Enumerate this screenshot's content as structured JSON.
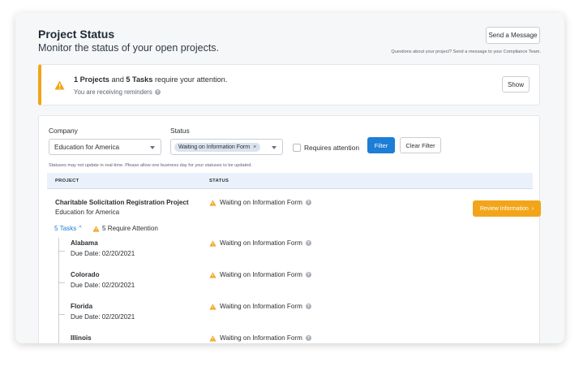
{
  "header": {
    "title": "Project Status",
    "subtitle": "Monitor the status of your open projects.",
    "send_label": "Send a Message",
    "help_text": "Questions about your project? Send a message to your Compliance Team."
  },
  "alert": {
    "projects_count": "1 Projects",
    "and_text": " and ",
    "tasks_count": "5 Tasks",
    "tail_text": " require your attention.",
    "sub_text": "You are receiving reminders",
    "show_label": "Show"
  },
  "filters": {
    "company_label": "Company",
    "company_value": "Education for America",
    "status_label": "Status",
    "status_chip": "Waiting on Information Form",
    "status_chip_remove": "×",
    "requires_label": "Requires attention",
    "filter_label": "Filter",
    "clear_label": "Clear Filter",
    "note": "Statuses may not update in real-time. Please allow one business day for your statuses to be updated."
  },
  "table": {
    "col_project": "PROJECT",
    "col_status": "STATUS",
    "project": {
      "name": "Charitable Solicitation Registration Project",
      "company": "Education for America",
      "status": "Waiting on Information Form",
      "review_label": "Review Information",
      "review_chevron": "›",
      "tasks_link": "5 Tasks",
      "tasks_chevron": "^",
      "attention": "5 Require Attention"
    },
    "tasks": [
      {
        "name": "Alabama",
        "due": "Due Date: 02/20/2021",
        "status": "Waiting on Information Form"
      },
      {
        "name": "Colorado",
        "due": "Due Date: 02/20/2021",
        "status": "Waiting on Information Form"
      },
      {
        "name": "Florida",
        "due": "Due Date: 02/20/2021",
        "status": "Waiting on Information Form"
      },
      {
        "name": "Illinois",
        "due": "",
        "status": "Waiting on Information Form"
      }
    ]
  },
  "icons": {
    "warning": "warning-icon",
    "help": "help-icon",
    "chevron_up": "chevron-up-icon",
    "chevron_right": "chevron-right-icon",
    "caret_down": "caret-down-icon"
  },
  "colors": {
    "accent_blue": "#1c7ed6",
    "warning_orange": "#f2a51a",
    "table_header": "#eaf1fa"
  }
}
